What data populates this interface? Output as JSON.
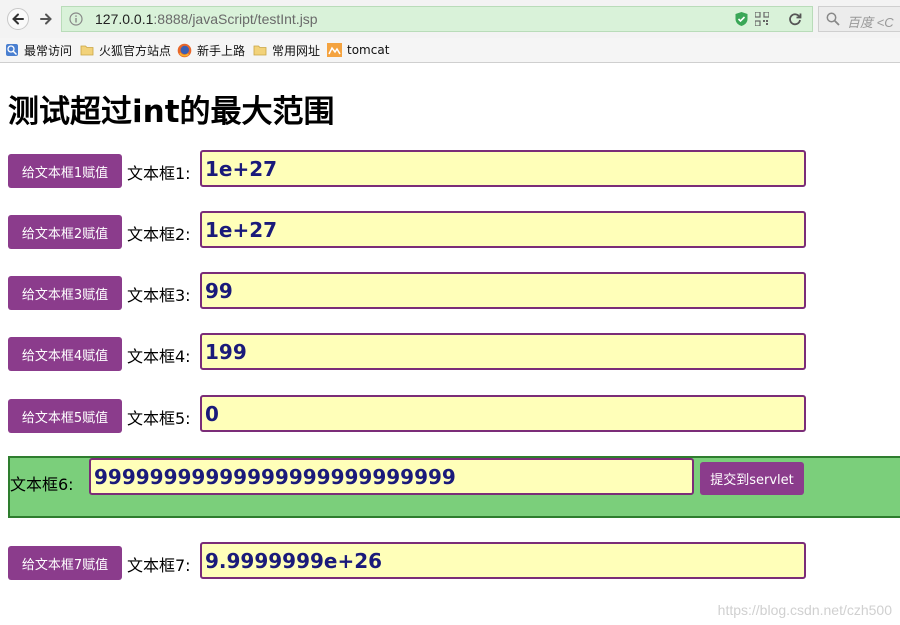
{
  "browser": {
    "url_host": "127.0.0.1",
    "url_path": ":8888/javaScript/testInt.jsp",
    "search_placeholder": "百度 <C"
  },
  "bookmarks": [
    {
      "label": "最常访问",
      "icon": "frequent-icon"
    },
    {
      "label": "火狐官方站点",
      "icon": "folder-icon"
    },
    {
      "label": "新手上路",
      "icon": "firefox-icon"
    },
    {
      "label": "常用网址",
      "icon": "folder-icon"
    },
    {
      "label": "tomcat",
      "icon": "tomcat-icon"
    }
  ],
  "page": {
    "title": "测试超过int的最大范围"
  },
  "rows": [
    {
      "button": "给文本框1赋值",
      "label": "文本框1:",
      "value": "1e+27"
    },
    {
      "button": "给文本框2赋值",
      "label": "文本框2:",
      "value": "1e+27"
    },
    {
      "button": "给文本框3赋值",
      "label": "文本框3:",
      "value": "99"
    },
    {
      "button": "给文本框4赋值",
      "label": "文本框4:",
      "value": "199"
    },
    {
      "button": "给文本框5赋值",
      "label": "文本框5:",
      "value": "0"
    }
  ],
  "form": {
    "label": "文本框6:",
    "value": "99999999999999999999999999",
    "submit": "提交到servlet"
  },
  "row7": {
    "button": "给文本框7赋值",
    "label": "文本框7:",
    "value": "9.9999999e+26"
  },
  "watermark": "https://blog.csdn.net/czh500",
  "colors": {
    "button_bg": "#8b3c8c",
    "input_bg": "#ffffb9",
    "input_text": "#1a1a7a",
    "form_bg": "#7bcf7b",
    "url_bar_bg": "#d9f2d9"
  }
}
